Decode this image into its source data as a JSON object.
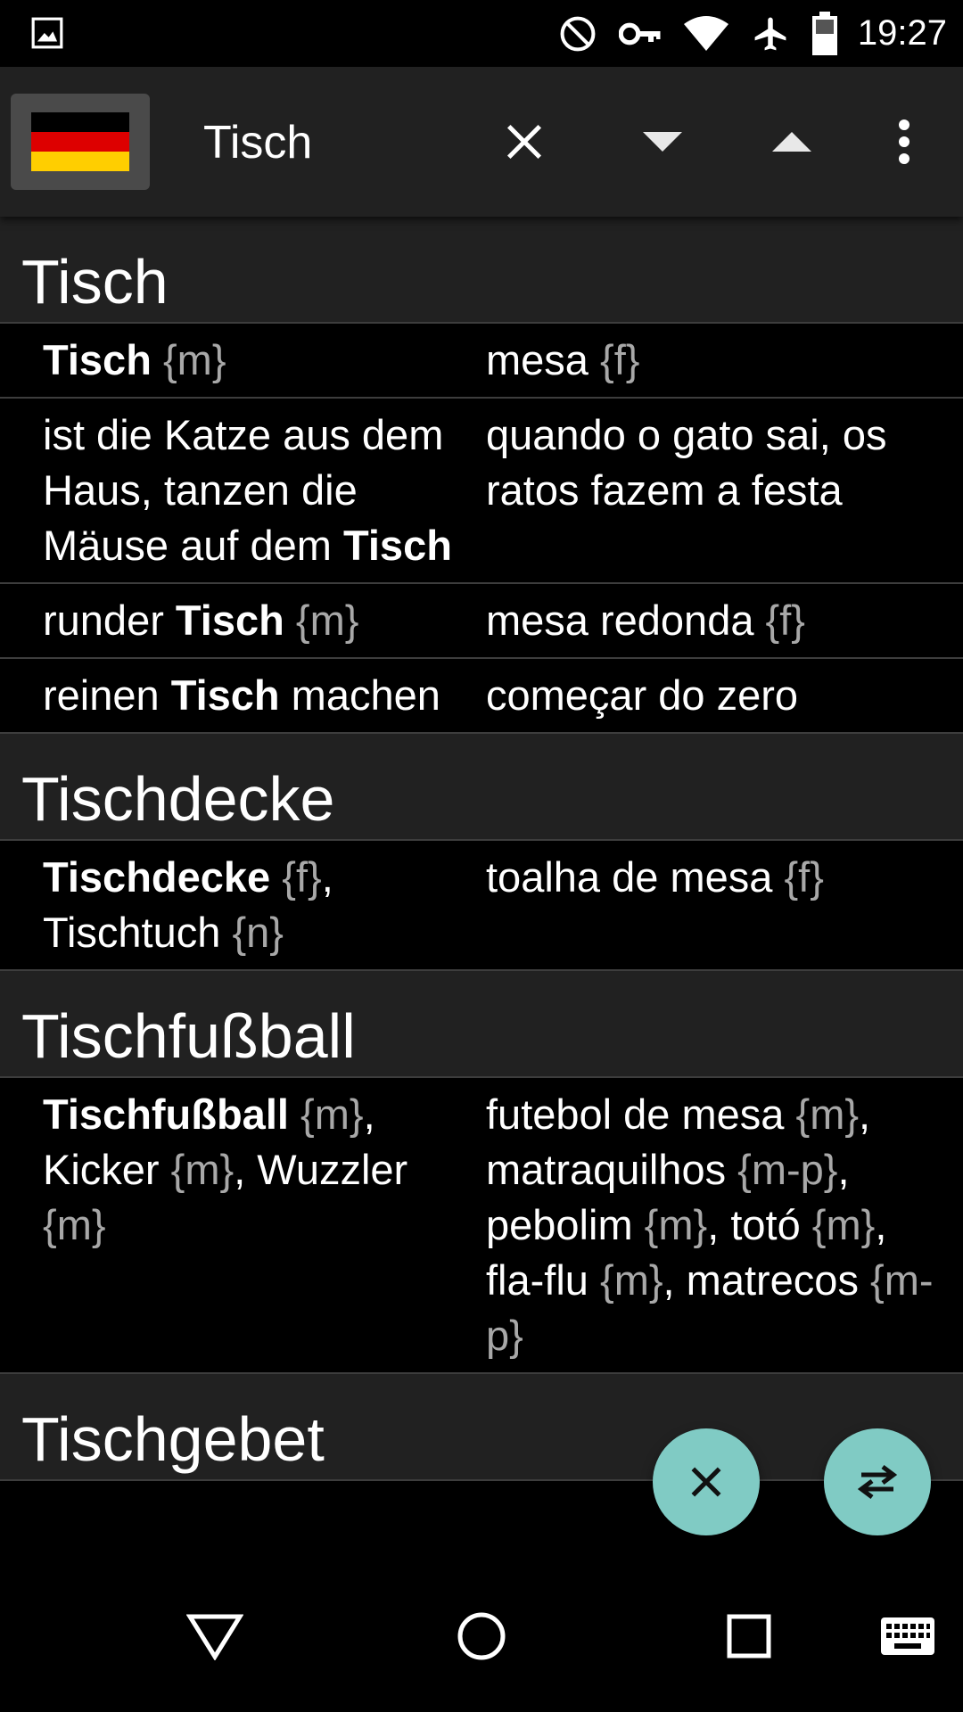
{
  "status_bar": {
    "time": "19:27",
    "icons": [
      "image-icon",
      "dnd-icon",
      "vpn-key-icon",
      "wifi-icon",
      "airplane-icon",
      "battery-icon"
    ]
  },
  "toolbar": {
    "language_flag": "germany-flag-icon",
    "search_value": "Tisch",
    "clear_icon": "close-icon",
    "next_icon": "arrow-down-icon",
    "prev_icon": "arrow-up-icon",
    "menu_icon": "more-vert-icon"
  },
  "sections": [
    {
      "header": "Tisch",
      "entries": [
        {
          "de_html": "<b>Tisch</b> <span class='g'>{m}</span>",
          "pt_html": "mesa <span class='g'>{f}</span>"
        },
        {
          "de_html": "ist die Katze aus dem Haus, tanzen die Mäuse auf dem <b>Tisch</b>",
          "pt_html": "quando o gato sai, os ratos fazem a festa"
        },
        {
          "de_html": "runder <b>Tisch</b> <span class='g'>{m}</span>",
          "pt_html": "mesa redonda <span class='g'>{f}</span>"
        },
        {
          "de_html": "reinen <b>Tisch</b> machen",
          "pt_html": "começar do zero"
        }
      ]
    },
    {
      "header": "Tischdecke",
      "entries": [
        {
          "de_html": "<b>Tischdecke</b> <span class='g'>{f}</span>, Tischtuch <span class='g'>{n}</span>",
          "pt_html": "toalha de mesa <span class='g'>{f}</span>"
        }
      ]
    },
    {
      "header": "Tischfußball",
      "entries": [
        {
          "de_html": "<b>Tischfußball</b> <span class='g'>{m}</span>, Kicker <span class='g'>{m}</span>, Wuzzler <span class='g'>{m}</span>",
          "pt_html": "futebol de mesa <span class='g'>{m}</span>, matraquilhos <span class='g'>{m-p}</span>, pebolim <span class='g'>{m}</span>, totó <span class='g'>{m}</span>, fla-flu <span class='g'>{m}</span>, matrecos <span class='g'>{m-p}</span>"
        }
      ]
    },
    {
      "header": "Tischgebet",
      "entries": []
    }
  ],
  "fabs": {
    "clear_icon": "close-icon",
    "swap_icon": "swap-languages-icon"
  },
  "colors": {
    "accent": "#80cbc4",
    "toolbar_bg": "#212121",
    "header_bg": "#212121",
    "row_bg": "#000000",
    "gender_tag": "#a8a8a8"
  },
  "nav_bar": {
    "icons": [
      "back-icon",
      "home-icon",
      "recents-icon",
      "keyboard-icon"
    ]
  }
}
